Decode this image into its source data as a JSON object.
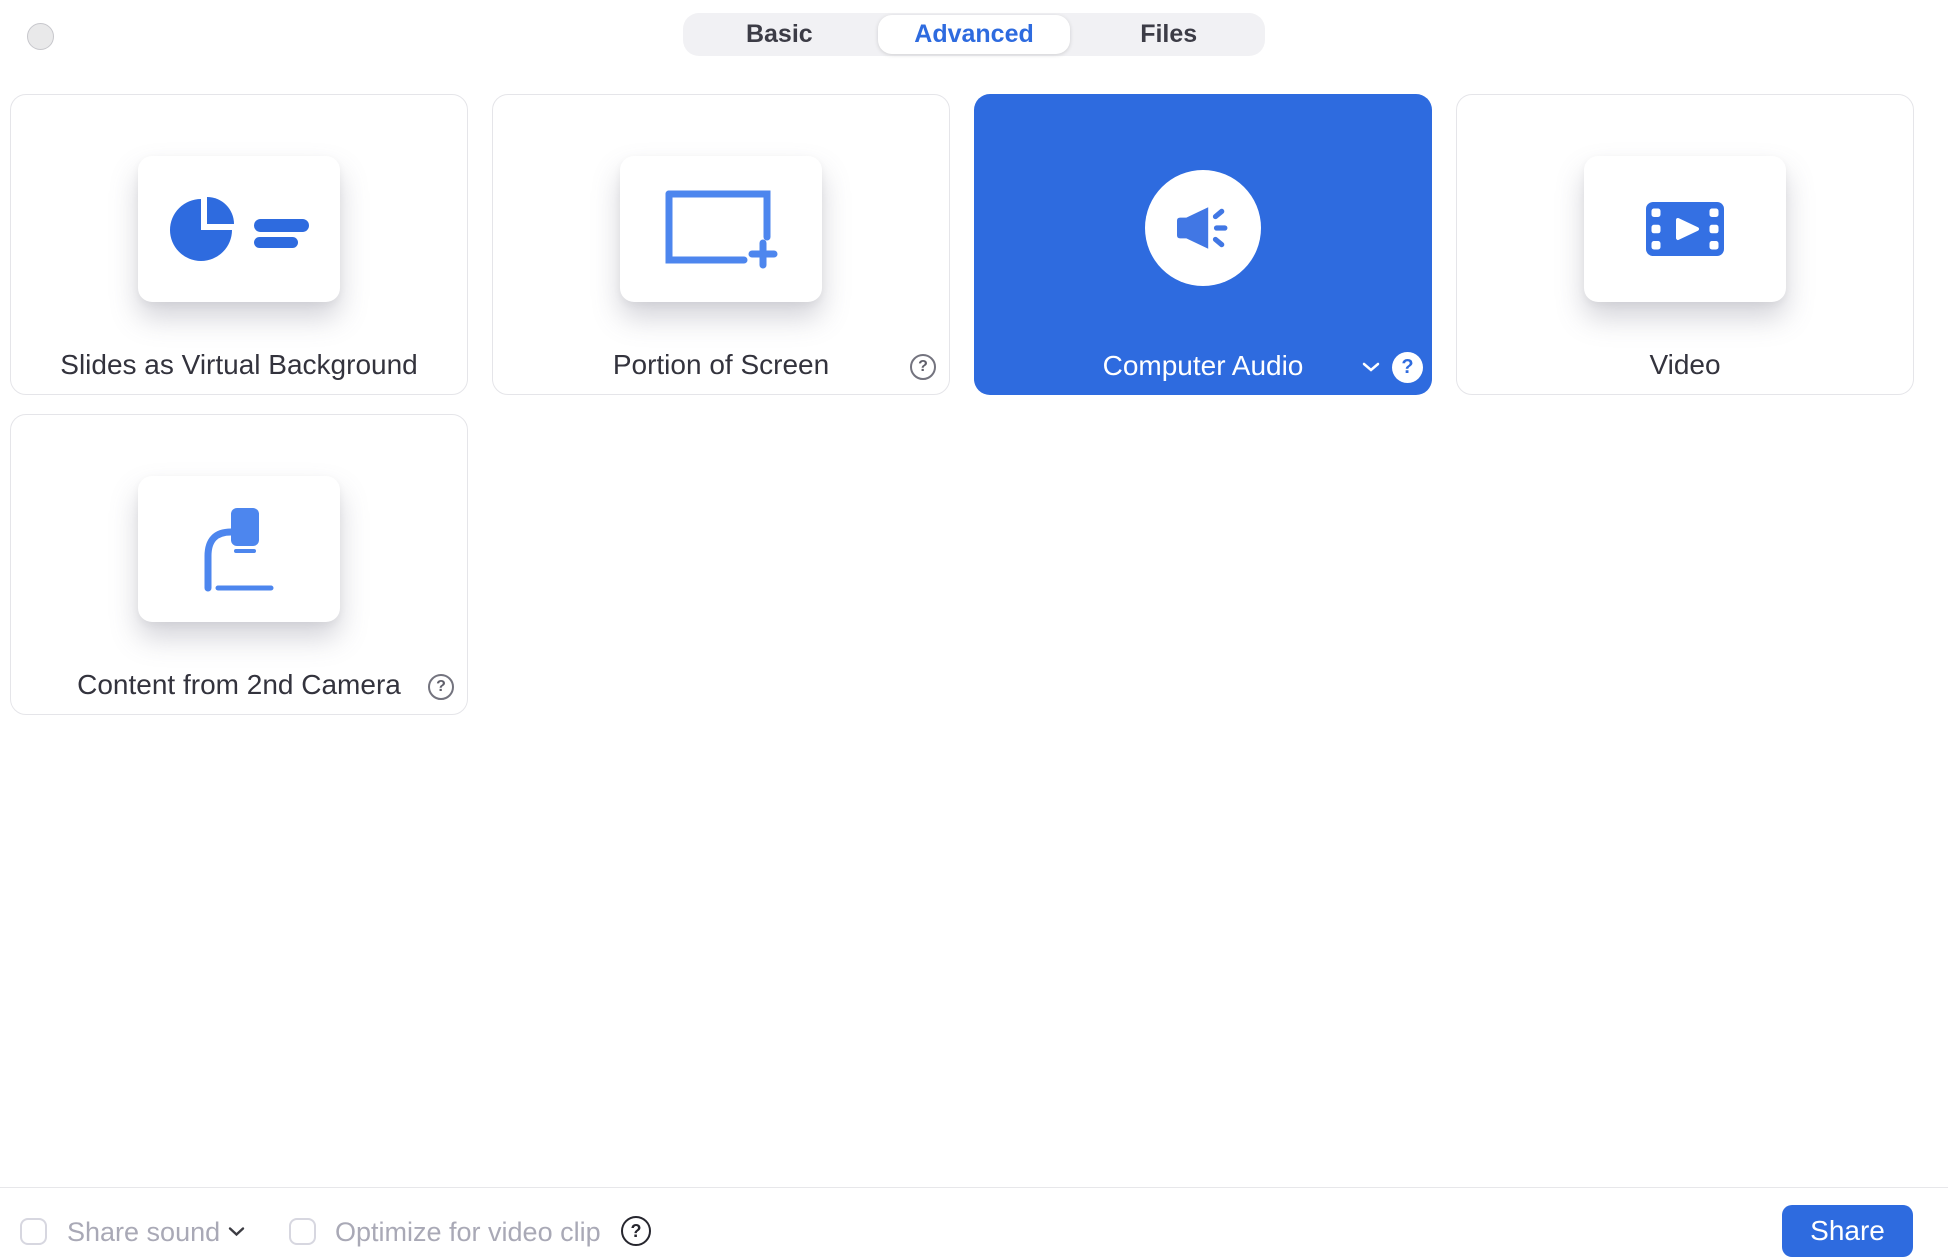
{
  "window": {
    "close_button_state": "inactive"
  },
  "tabs": {
    "selected": "Advanced",
    "items": [
      {
        "label": "Basic"
      },
      {
        "label": "Advanced"
      },
      {
        "label": "Files"
      }
    ]
  },
  "cards": [
    {
      "label": "Slides as Virtual Background",
      "icon": "pie-presentation-icon",
      "selected": false
    },
    {
      "label": "Portion of Screen",
      "icon": "screen-portion-plus-icon",
      "selected": false,
      "help": "?"
    },
    {
      "label": "Computer Audio",
      "icon": "speaker-sound-icon",
      "selected": true,
      "help": "?",
      "has_dropdown": true
    },
    {
      "label": "Video",
      "icon": "film-strip-play-icon",
      "selected": false
    },
    {
      "label": "Content from 2nd Camera",
      "icon": "document-camera-icon",
      "selected": false,
      "help": "?"
    }
  ],
  "footer": {
    "share_sound_label": "Share sound",
    "share_sound_checked": false,
    "optimize_label": "Optimize for video clip",
    "optimize_checked": false,
    "optimize_help": "?",
    "share_button_label": "Share"
  },
  "colors": {
    "accent_blue": "#2e6bdf",
    "icon_outline_blue": "#4d86ee",
    "speaker_blue": "#4177e4",
    "film_blue": "#3470e3",
    "text_dark": "#33333d",
    "text_muted": "#a9a9b6",
    "card_border": "#e5e5e9",
    "segmented_bg": "#f1f1f4",
    "divider": "#e7e7ea",
    "checkbox_border": "#d7d7e0"
  }
}
